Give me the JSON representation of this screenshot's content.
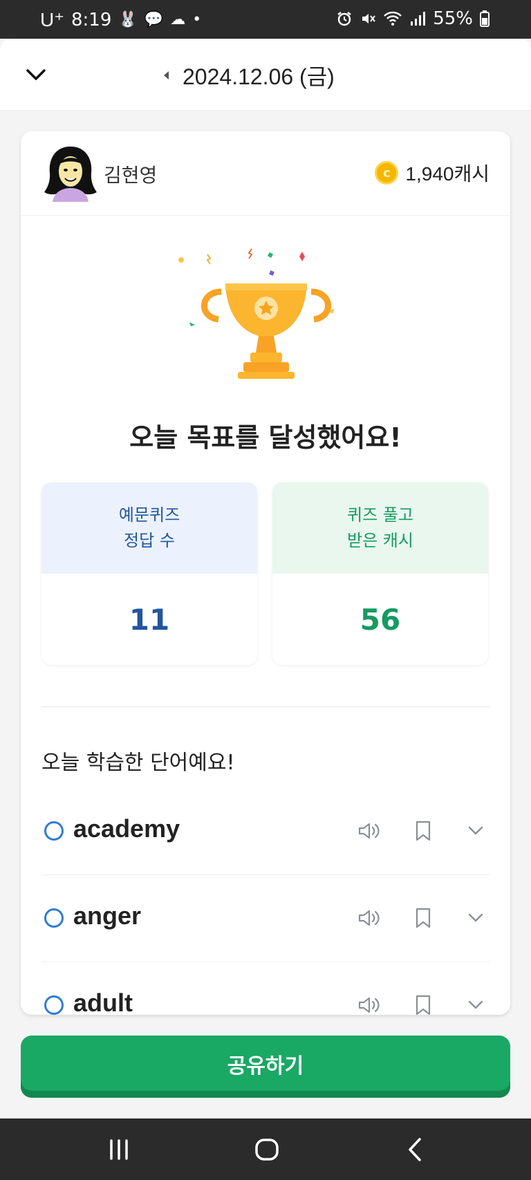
{
  "status_bar": {
    "carrier": "U⁺",
    "time": "8:19",
    "battery": "55%"
  },
  "header": {
    "date": "2024.12.06 (금)"
  },
  "profile": {
    "username": "김현영",
    "cash": "1,940캐시"
  },
  "goal": {
    "title": "오늘 목표를 달성했어요!"
  },
  "stats": {
    "quiz_correct_label": "예문퀴즈\n정답 수",
    "quiz_correct_value": "11",
    "cash_earned_label": "퀴즈 풀고\n받은 캐시",
    "cash_earned_value": "56"
  },
  "words": {
    "title": "오늘 학습한 단어예요!",
    "items": [
      {
        "word": "academy"
      },
      {
        "word": "anger"
      },
      {
        "word": "adult"
      }
    ]
  },
  "actions": {
    "share_label": "공유하기"
  },
  "colors": {
    "accent_green": "#1aa865",
    "accent_blue": "#23569c",
    "coin_gold": "#f7b500"
  }
}
